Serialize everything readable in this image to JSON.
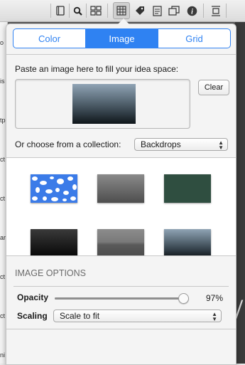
{
  "background_window": {
    "left_fragments": [
      "o",
      "is",
      "tp",
      "ct",
      "ct",
      "ar",
      "ct",
      "ct",
      "ni"
    ]
  },
  "toolbar": {
    "icons": [
      "book-icon",
      "magnifier-icon",
      "layout-grid-icon",
      "background-grid-icon",
      "tag-icon",
      "document-icon",
      "window-stack-icon",
      "info-icon",
      "fit-page-icon"
    ],
    "active": "background-grid-icon"
  },
  "popover": {
    "tabs": [
      {
        "label": "Color",
        "selected": false
      },
      {
        "label": "Image",
        "selected": true
      },
      {
        "label": "Grid",
        "selected": false
      }
    ],
    "paste_label": "Paste an image here to fill your idea space:",
    "clear_label": "Clear",
    "collection_label": "Or choose from a collection:",
    "collection_value": "Backdrops",
    "backdrops": [
      {
        "name": "blue-cells",
        "color": "#3b7be8"
      },
      {
        "name": "gray-gradient",
        "color": "#6a6a6a"
      },
      {
        "name": "dark-green",
        "color": "#2f4e40"
      },
      {
        "name": "black-gradient",
        "color": "#111111"
      },
      {
        "name": "gray-horizon",
        "color": "#777777"
      },
      {
        "name": "blue-gray-rain",
        "color": "#4a5a66"
      }
    ],
    "image_options_title": "IMAGE OPTIONS",
    "opacity_label": "Opacity",
    "opacity_value": 0.97,
    "opacity_text": "97%",
    "scaling_label": "Scaling",
    "scaling_value": "Scale to fit"
  },
  "colors": {
    "accent": "#2f82f2"
  }
}
